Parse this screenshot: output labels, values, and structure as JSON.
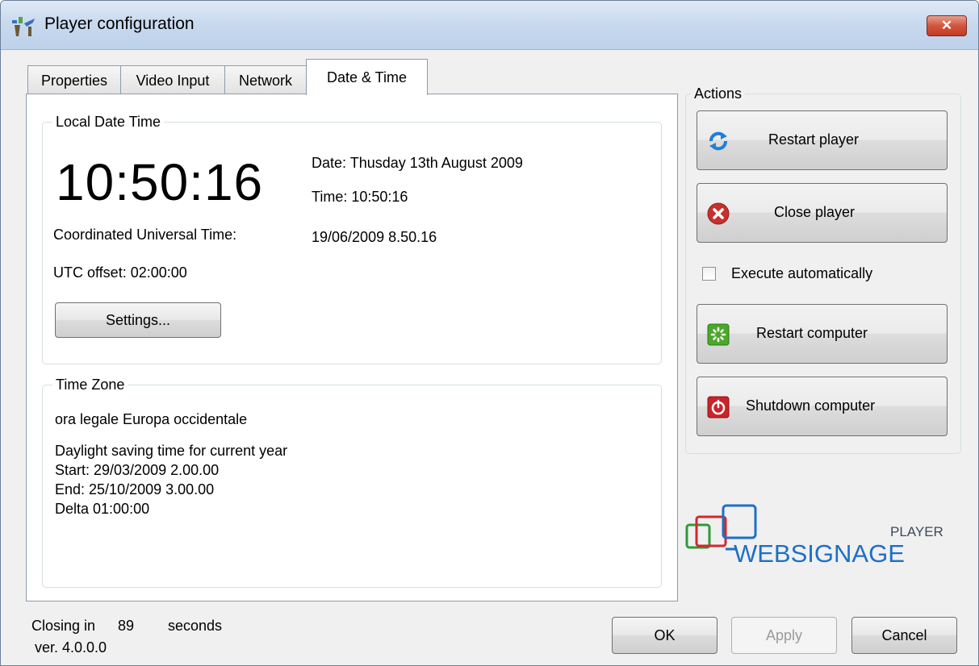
{
  "window": {
    "title": "Player configuration",
    "close_glyph": "✕"
  },
  "tabs": [
    {
      "label": "Properties"
    },
    {
      "label": "Video Input"
    },
    {
      "label": "Network"
    },
    {
      "label": "Date & Time",
      "active": true
    }
  ],
  "local_date_time": {
    "legend": "Local Date Time",
    "clock": "10:50:16",
    "date_line": "Date: Thusday 13th August 2009",
    "time_line": "Time: 10:50:16",
    "utc_label": "Coordinated Universal Time:",
    "utc_value": "19/06/2009 8.50.16",
    "utc_offset": "UTC offset: 02:00:00",
    "settings_label": "Settings..."
  },
  "time_zone": {
    "legend": "Time Zone",
    "name": "ora legale Europa occidentale",
    "dst_title": "Daylight saving time for current year",
    "start": "Start: 29/03/2009 2.00.00",
    "end": "End: 25/10/2009 3.00.00",
    "delta": "Delta 01:00:00"
  },
  "actions": {
    "legend": "Actions",
    "restart_player": "Restart player",
    "close_player": "Close player",
    "execute_automatically": "Execute automatically",
    "execute_checked": false,
    "restart_computer": "Restart computer",
    "shutdown_computer": "Shutdown computer"
  },
  "logo": {
    "word": "WEBSIGNAGE",
    "sub": "PLAYER"
  },
  "footer": {
    "closing_prefix": "Closing in",
    "closing_seconds": "89",
    "closing_suffix": "seconds",
    "version": "ver. 4.0.0.0",
    "ok": "OK",
    "apply": "Apply",
    "cancel": "Cancel"
  },
  "colors": {
    "titlebar": "#c9daee",
    "close": "#c23b22",
    "logo_blue": "#1e6fc7",
    "logo_red": "#d6262c",
    "logo_green": "#2e9a3a"
  },
  "icons": [
    "app-icon",
    "close-icon",
    "refresh-icon",
    "error-icon",
    "restart-computer-icon",
    "power-icon"
  ]
}
